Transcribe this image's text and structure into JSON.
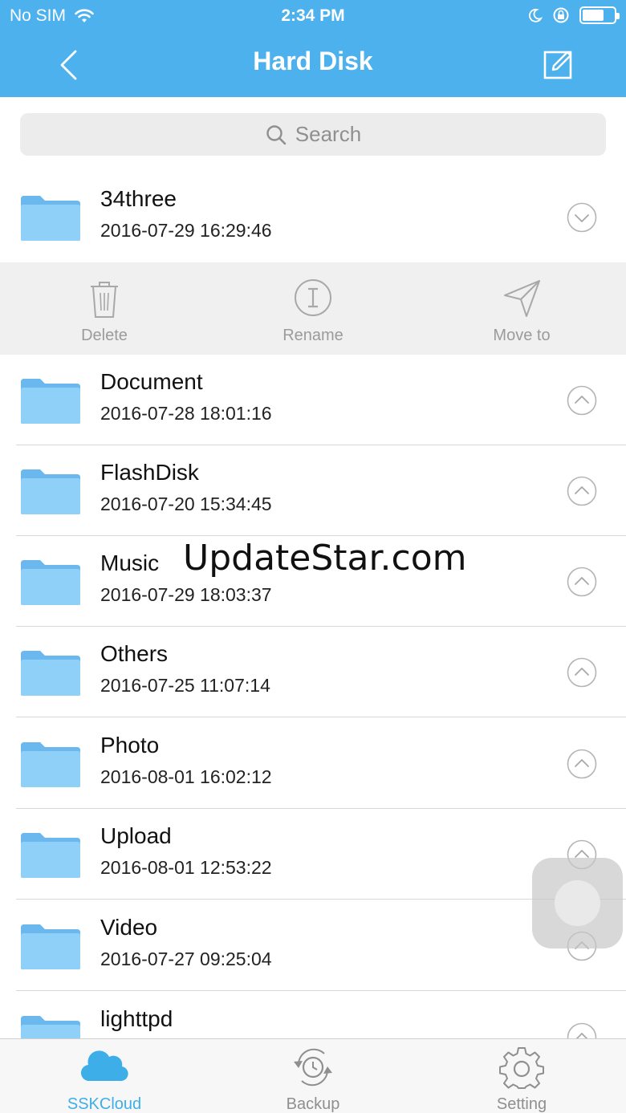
{
  "status_bar": {
    "carrier": "No SIM",
    "time": "2:34 PM"
  },
  "header": {
    "title": "Hard Disk",
    "bg_color": "#4db1ee"
  },
  "search": {
    "placeholder": "Search"
  },
  "files": [
    {
      "name": "34three",
      "date": "2016-07-29 16:29:46",
      "expanded": true
    },
    {
      "name": "Document",
      "date": "2016-07-28 18:01:16"
    },
    {
      "name": "FlashDisk",
      "date": "2016-07-20 15:34:45"
    },
    {
      "name": "Music",
      "date": "2016-07-29 18:03:37"
    },
    {
      "name": "Others",
      "date": "2016-07-25 11:07:14"
    },
    {
      "name": "Photo",
      "date": "2016-08-01 16:02:12"
    },
    {
      "name": "Upload",
      "date": "2016-08-01 12:53:22"
    },
    {
      "name": "Video",
      "date": "2016-07-27 09:25:04"
    },
    {
      "name": "lighttpd",
      "date": ""
    }
  ],
  "actions": {
    "delete": "Delete",
    "rename": "Rename",
    "move_to": "Move to"
  },
  "watermark": "UpdateStar.com",
  "tabs": [
    {
      "label": "SSKCloud",
      "icon": "cloud-icon",
      "active": true
    },
    {
      "label": "Backup",
      "icon": "backup-clock-icon"
    },
    {
      "label": "Setting",
      "icon": "gear-icon"
    }
  ],
  "colors": {
    "accent": "#3eaee8",
    "folder": "#7cc4f4"
  }
}
